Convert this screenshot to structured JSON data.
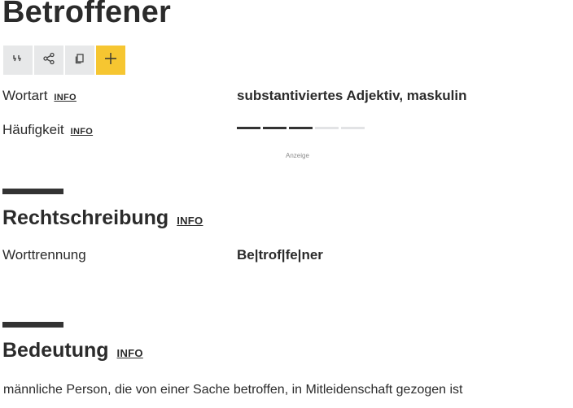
{
  "entry": {
    "title": "Betroffener"
  },
  "toolbar": {
    "quote_icon": "quote-icon",
    "share_icon": "share-icon",
    "copy_icon": "copy-icon",
    "add_icon": "plus-icon",
    "add_color": "#f6c631"
  },
  "grammar": {
    "wortart_label": "Wortart",
    "wortart_info": "INFO",
    "wortart_value": "substantiviertes Adjektiv, maskulin",
    "haeufigkeit_label": "Häufigkeit",
    "haeufigkeit_info": "INFO",
    "haeufigkeit_level": 3,
    "haeufigkeit_max": 5
  },
  "ad": {
    "label": "Anzeige"
  },
  "rechtschreibung": {
    "heading": "Rechtschreibung",
    "info": "INFO",
    "worttrennung_label": "Worttrennung",
    "worttrennung_value": "Be|trof|fe|ner"
  },
  "bedeutung": {
    "heading": "Bedeutung",
    "info": "INFO",
    "text": "männliche Person, die von einer Sache betroffen, in Mitleidenschaft gezogen ist"
  }
}
